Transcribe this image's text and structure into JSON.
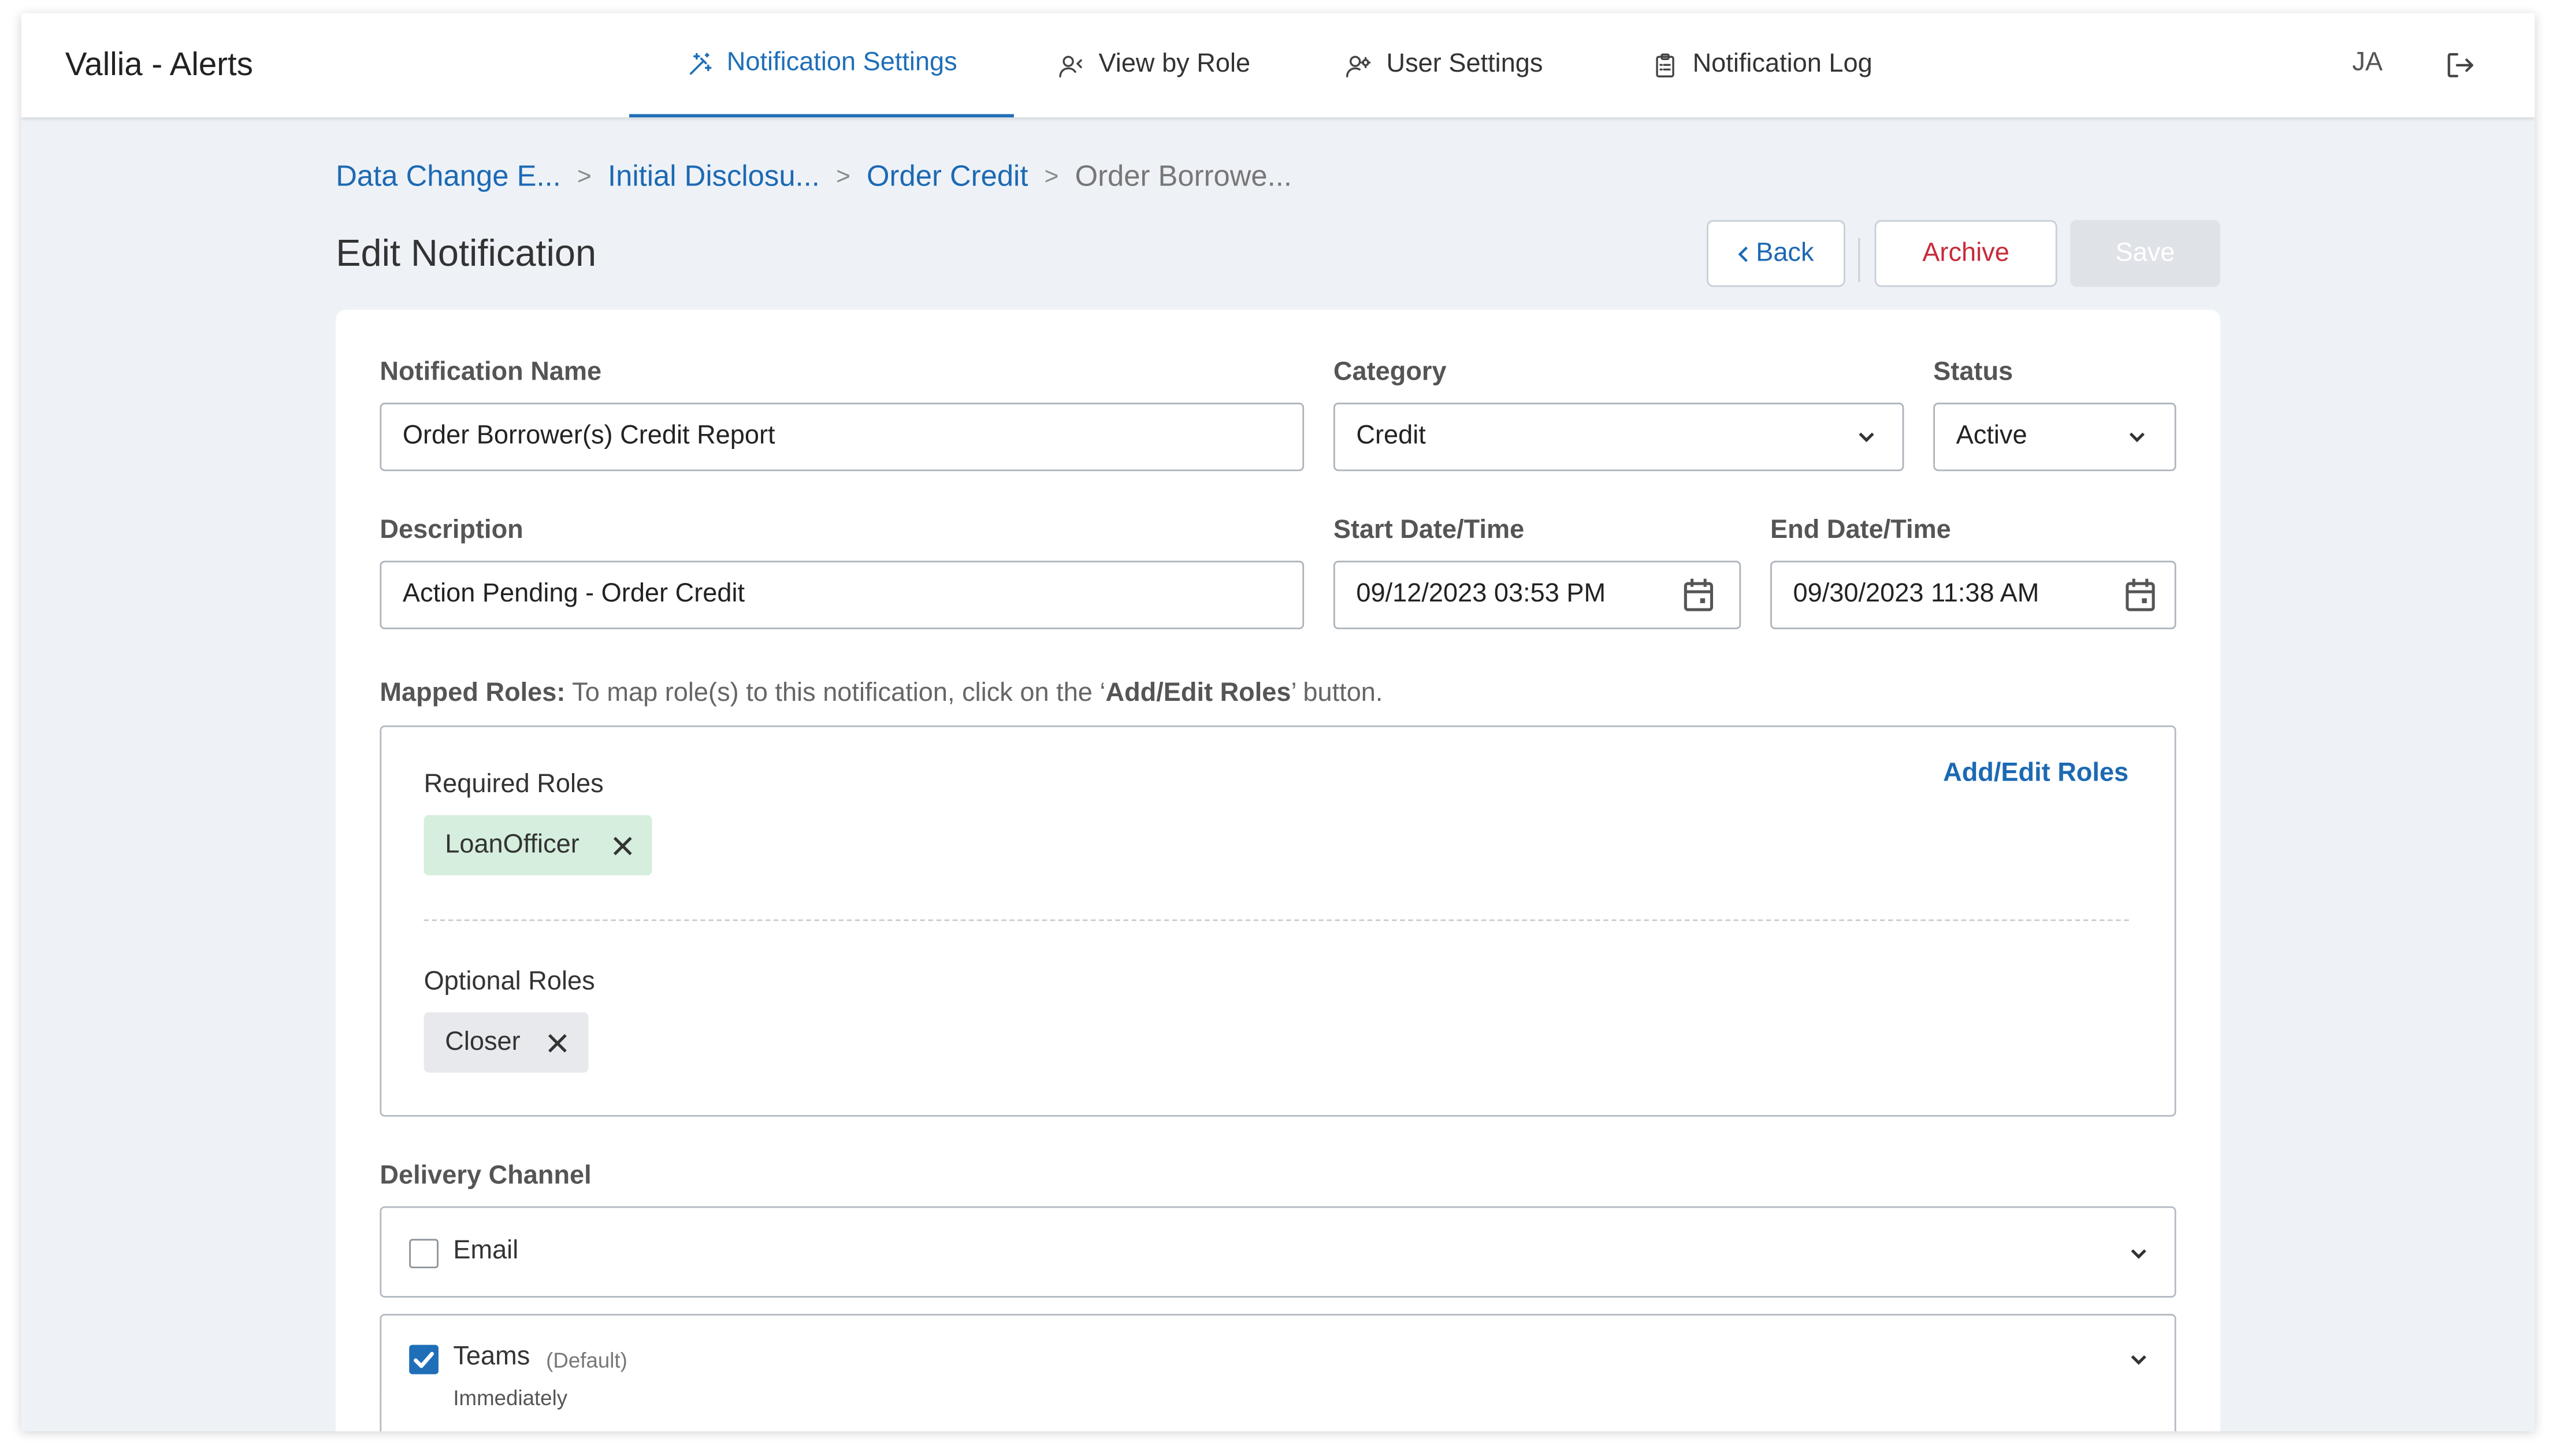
{
  "app": {
    "title": "Vallia - Alerts",
    "user_initials": "JA"
  },
  "nav": {
    "tabs": [
      {
        "label": "Notification Settings",
        "active": true,
        "icon": "magic-wand-icon"
      },
      {
        "label": "View by Role",
        "active": false,
        "icon": "user-role-icon"
      },
      {
        "label": "User Settings",
        "active": false,
        "icon": "user-gear-icon"
      },
      {
        "label": "Notification Log",
        "active": false,
        "icon": "clipboard-icon"
      }
    ]
  },
  "breadcrumb": [
    "Data Change E...",
    "Initial Disclosu...",
    "Order Credit",
    "Order Borrowe..."
  ],
  "page": {
    "title": "Edit Notification"
  },
  "actions": {
    "back": "Back",
    "archive": "Archive",
    "save": "Save"
  },
  "form": {
    "name_label": "Notification Name",
    "name_value": "Order Borrower(s) Credit Report",
    "category_label": "Category",
    "category_value": "Credit",
    "status_label": "Status",
    "status_value": "Active",
    "description_label": "Description",
    "description_value": "Action Pending - Order Credit",
    "start_label": "Start Date/Time",
    "start_value": "09/12/2023 03:53 PM",
    "end_label": "End Date/Time",
    "end_value": "09/30/2023 11:38 AM"
  },
  "roles": {
    "help_bold": "Mapped Roles:",
    "help_text_1": " To map role(s) to this notification, click on the ‘",
    "help_bold_2": "Add/Edit Roles",
    "help_text_2": "’ button.",
    "add_edit": "Add/Edit Roles",
    "required_label": "Required Roles",
    "required": [
      "LoanOfficer"
    ],
    "optional_label": "Optional Roles",
    "optional": [
      "Closer"
    ]
  },
  "delivery": {
    "label": "Delivery Channel",
    "channels": [
      {
        "name": "Email",
        "checked": false
      },
      {
        "name": "Teams",
        "tag": "(Default)",
        "checked": true,
        "sub": "Immediately"
      }
    ]
  },
  "colors": {
    "accent": "#1f6fb8",
    "danger": "#c62b3a",
    "chip_required": "#d6eedd",
    "chip_optional": "#e7e9ec"
  }
}
